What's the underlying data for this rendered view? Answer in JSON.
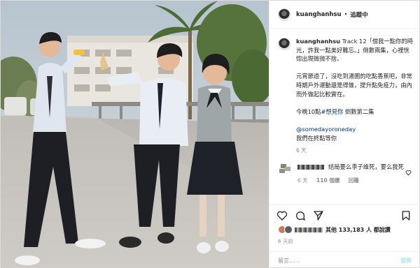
{
  "header": {
    "username": "kuanghanhsu",
    "separator": "•",
    "follow_label": "追蹤中"
  },
  "caption": {
    "username": "kuanghanhsu",
    "line1": "Track 12「借我一點你的時光，許我一點美好難忘。」倒數兩集，心裡恍惚出現微微不捨。",
    "line2": "元宵節過了，沒吃到湯圓的吃點香蕉吧，非常時期戶外運動還是得做，提升點免疫力，由內而外做起比較實在。",
    "line3_prefix": "今晚10點",
    "line3_tag": "#想見你",
    "line3_suffix": " 倒數第二集",
    "mention": "@somedayoroneday",
    "line4": "我們在終點等你",
    "timestamp": "6 天"
  },
  "comment": {
    "text": "结局要么李子维死，要么我死",
    "time": "6 天",
    "likes": "110 個讚",
    "reply": "回覆"
  },
  "likes_summary": {
    "text": "其他 133,183 人 都說讚"
  },
  "post_date": "6 天前",
  "add_comment": {
    "placeholder": "留言......",
    "post_label": "發佈"
  },
  "icons": [
    "heart-icon",
    "comment-icon",
    "share-icon",
    "bookmark-icon",
    "small-heart-icon"
  ]
}
